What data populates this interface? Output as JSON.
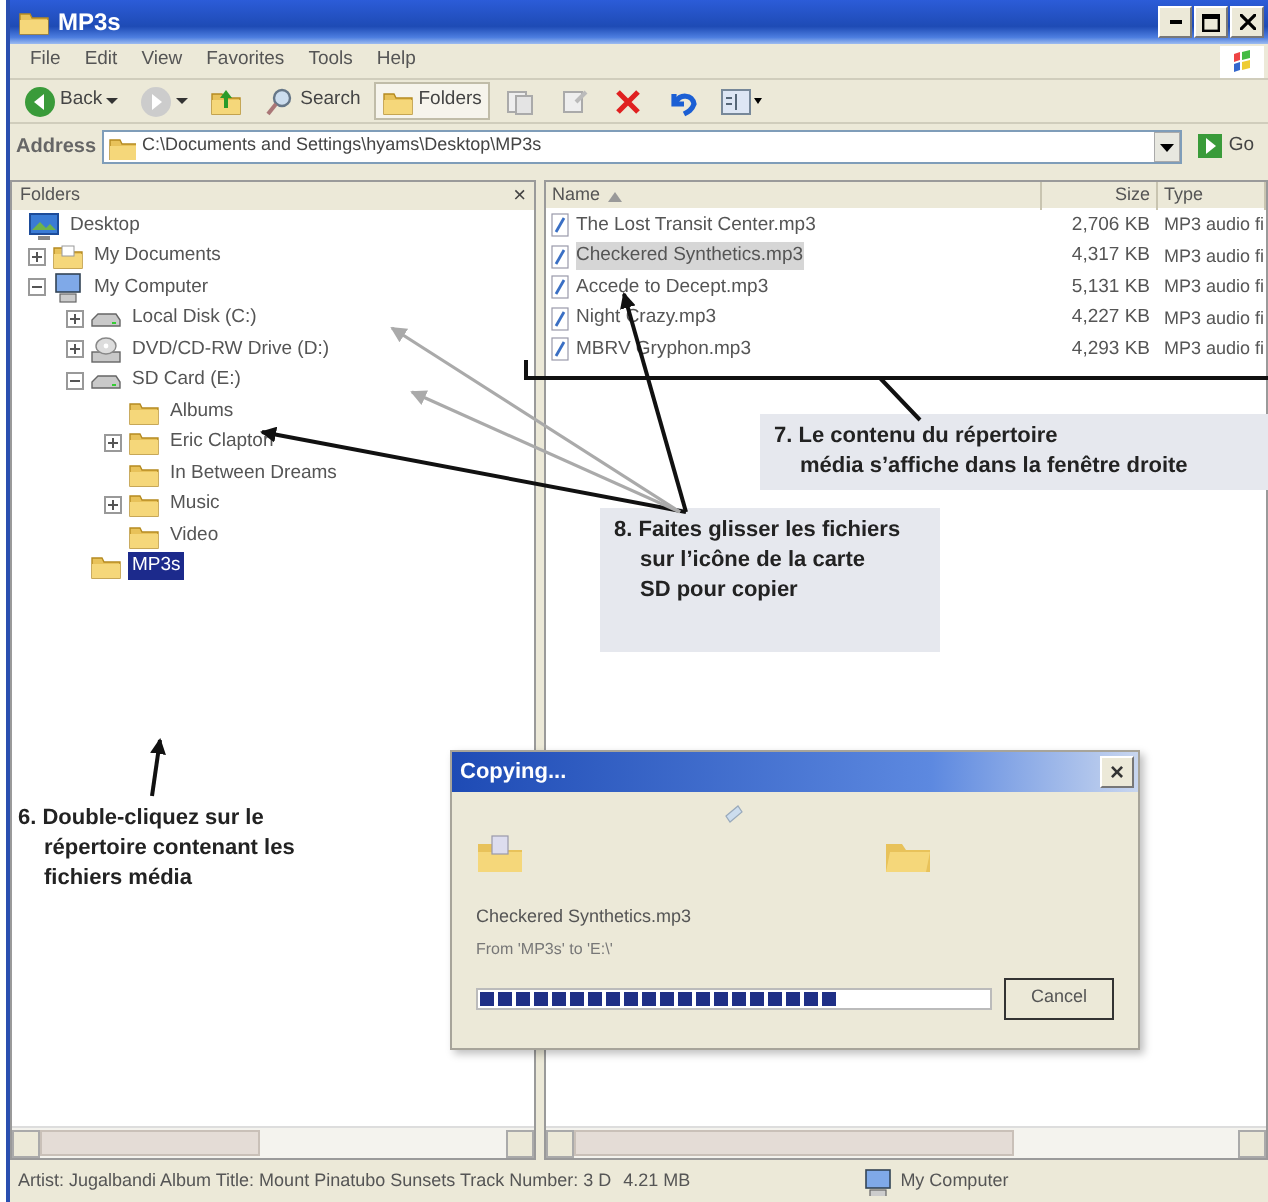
{
  "window": {
    "title": "MP3s"
  },
  "menu": [
    "File",
    "Edit",
    "View",
    "Favorites",
    "Tools",
    "Help"
  ],
  "toolbar": [
    {
      "kind": "back",
      "label": "Back"
    },
    {
      "kind": "forward"
    },
    {
      "kind": "up"
    },
    {
      "kind": "search",
      "label": "Search"
    },
    {
      "kind": "folders",
      "label": "Folders",
      "selected": true
    },
    {
      "kind": "move"
    },
    {
      "kind": "copy"
    },
    {
      "kind": "delete"
    },
    {
      "kind": "undo"
    },
    {
      "kind": "views"
    }
  ],
  "address": {
    "label": "Address",
    "value": "C:\\Documents and Settings\\hyams\\Desktop\\MP3s",
    "go": "Go"
  },
  "folders_pane": {
    "title": "Folders",
    "close": "×",
    "tree": [
      {
        "label": "Desktop",
        "kind": "desktop",
        "selected": false,
        "children": [
          {
            "label": "My Documents",
            "kind": "documents",
            "expanded": false,
            "selected": false
          },
          {
            "label": "My Computer",
            "kind": "computer",
            "expanded": true,
            "selected": false,
            "children": [
              {
                "label": "Local Disk (C:)",
                "kind": "drive",
                "expanded": false,
                "selected": false
              },
              {
                "label": "DVD/CD-RW Drive (D:)",
                "kind": "cdrom",
                "expanded": false,
                "selected": false
              },
              {
                "label": "SD Card (E:)",
                "kind": "drive",
                "expanded": true,
                "selected": false,
                "children": [
                  {
                    "label": "Albums",
                    "kind": "folder",
                    "selected": false
                  },
                  {
                    "label": "Eric Clapton",
                    "kind": "folder",
                    "expanded": false,
                    "selected": false
                  },
                  {
                    "label": "In Between Dreams",
                    "kind": "folder",
                    "selected": false
                  },
                  {
                    "label": "Music",
                    "kind": "folder",
                    "expanded": false,
                    "selected": false
                  },
                  {
                    "label": "Video",
                    "kind": "folder",
                    "selected": false
                  }
                ]
              },
              {
                "label": "MP3s",
                "kind": "folder",
                "selected": true
              }
            ]
          }
        ]
      }
    ]
  },
  "file_list": {
    "columns": [
      "Name",
      "Size",
      "Type"
    ],
    "rows": [
      {
        "name": "The Lost Transit Center.mp3",
        "size": "2,706 KB",
        "type": "MP3 audio fi",
        "selected": false
      },
      {
        "name": "Checkered Synthetics.mp3",
        "size": "4,317 KB",
        "type": "MP3 audio fi",
        "selected": true
      },
      {
        "name": "Accede to Decept.mp3",
        "size": "5,131 KB",
        "type": "MP3 audio fi",
        "selected": false
      },
      {
        "name": "Night Crazy.mp3",
        "size": "4,227 KB",
        "type": "MP3 audio fi",
        "selected": false
      },
      {
        "name": "MBRV Gryphon.mp3",
        "size": "4,293 KB",
        "type": "MP3 audio fi",
        "selected": false
      }
    ]
  },
  "status_bar": {
    "details": "Artist: Jugalbandi Album Title: Mount Pinatubo Sunsets Track Number: 3 D",
    "size": "4.21 MB",
    "zone": "My Computer"
  },
  "copy_dialog": {
    "title": "Copying...",
    "close": "×",
    "file": "Checkered Synthetics.mp3",
    "from_to": "From 'MP3s' to 'E:\\'",
    "level": 0.7,
    "button": "Cancel"
  },
  "callouts": [
    {
      "kind": "files",
      "text": "7. Le contenu du répertoire\nmédia s’affiche dans la fenêtre droite"
    },
    {
      "kind": "drag",
      "text": "8. Faites glisser les fichiers\nsur l’icône de la carte\nSD pour copier"
    },
    {
      "kind": "folder",
      "text": "6. Double-cliquez sur le\nrépertoire contenant les\nfichiers média"
    }
  ]
}
